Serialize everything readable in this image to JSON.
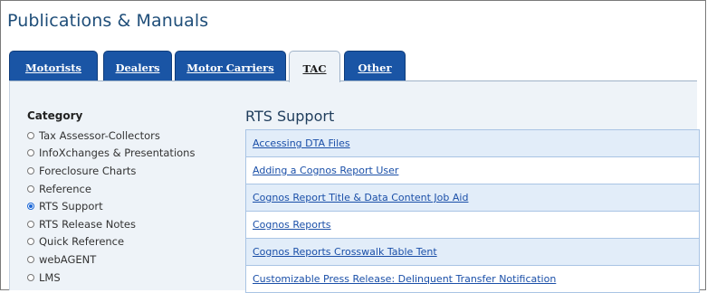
{
  "page": {
    "title": "Publications & Manuals"
  },
  "tabs": [
    {
      "label": "Motorists",
      "active": false
    },
    {
      "label": "Dealers",
      "active": false
    },
    {
      "label": "Motor Carriers",
      "active": false
    },
    {
      "label": "TAC",
      "active": true
    },
    {
      "label": "Other",
      "active": false
    }
  ],
  "category": {
    "heading": "Category",
    "items": [
      {
        "label": "Tax Assessor-Collectors",
        "checked": false
      },
      {
        "label": "InfoXchanges & Presentations",
        "checked": false
      },
      {
        "label": "Foreclosure Charts",
        "checked": false
      },
      {
        "label": "Reference",
        "checked": false
      },
      {
        "label": "RTS Support",
        "checked": true
      },
      {
        "label": "RTS Release Notes",
        "checked": false
      },
      {
        "label": "Quick Reference",
        "checked": false
      },
      {
        "label": "webAGENT",
        "checked": false
      },
      {
        "label": "LMS",
        "checked": false
      }
    ]
  },
  "section": {
    "title": "RTS Support",
    "links": [
      "Accessing DTA Files",
      "Adding a Cognos Report User",
      "Cognos Report Title & Data Content Job Aid",
      "Cognos Reports",
      "Cognos Reports Crosswalk Table Tent",
      "Customizable Press Release: Delinquent Transfer Notification"
    ]
  },
  "colors": {
    "tab_bg": "#1a55a5",
    "tab_active_bg": "#eef3f8",
    "panel_bg": "#eef3f8",
    "link": "#1a4fa8",
    "row_alt": "#e2edf9",
    "title": "#1f4e79"
  }
}
